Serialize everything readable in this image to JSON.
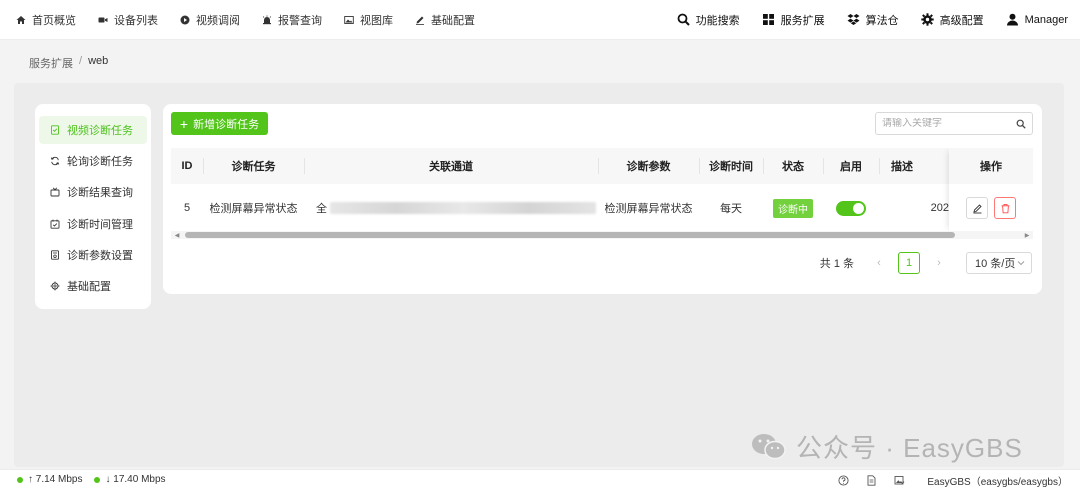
{
  "topnav": {
    "left": [
      {
        "label": "首页概览",
        "icon": "home-icon"
      },
      {
        "label": "设备列表",
        "icon": "camera-icon"
      },
      {
        "label": "视频调阅",
        "icon": "play-circle-icon"
      },
      {
        "label": "报警查询",
        "icon": "alarm-icon"
      },
      {
        "label": "视图库",
        "icon": "image-icon"
      },
      {
        "label": "基础配置",
        "icon": "pen-icon"
      }
    ],
    "right": [
      {
        "label": "功能搜索",
        "icon": "search-icon"
      },
      {
        "label": "服务扩展",
        "icon": "grid-icon"
      },
      {
        "label": "算法仓",
        "icon": "dropbox-icon"
      },
      {
        "label": "高级配置",
        "icon": "gear-icon"
      },
      {
        "label": "Manager",
        "icon": "user-icon"
      }
    ]
  },
  "breadcrumb": {
    "parent": "服务扩展",
    "sep": "/",
    "current": "web"
  },
  "sidemenu": [
    {
      "label": "视频诊断任务",
      "icon": "doc-check-icon",
      "active": true
    },
    {
      "label": "轮询诊断任务",
      "icon": "refresh-icon",
      "active": false
    },
    {
      "label": "诊断结果查询",
      "icon": "tv-icon",
      "active": false
    },
    {
      "label": "诊断时间管理",
      "icon": "calendar-check-icon",
      "active": false
    },
    {
      "label": "诊断参数设置",
      "icon": "doc-settings-icon",
      "active": false
    },
    {
      "label": "基础配置",
      "icon": "gear-icon",
      "active": false
    }
  ],
  "toolbar": {
    "add_label": "新增诊断任务",
    "search_placeholder": "请输入关键字"
  },
  "table": {
    "columns": [
      "ID",
      "诊断任务",
      "关联通道",
      "诊断参数",
      "诊断时间",
      "状态",
      "启用",
      "描述",
      "操作"
    ],
    "rows": [
      {
        "id": "5",
        "task": "检测屏幕异常状态",
        "channel_prefix": "全",
        "param": "检测屏幕异常状态",
        "time": "每天",
        "status": "诊断中",
        "enabled": true,
        "desc": "202"
      }
    ]
  },
  "pagination": {
    "total": "共 1 条",
    "current": "1",
    "page_size": "10 条/页",
    "prev": "‹",
    "next": "›"
  },
  "watermark": {
    "text": "公众号 · EasyGBS"
  },
  "statusbar": {
    "up": "↑ 7.14 Mbps",
    "down": "↓ 17.40 Mbps",
    "version": "EasyGBS（easygbs/easygbs）"
  },
  "colors": {
    "accent": "#52c41a",
    "danger": "#ff4d4f"
  }
}
